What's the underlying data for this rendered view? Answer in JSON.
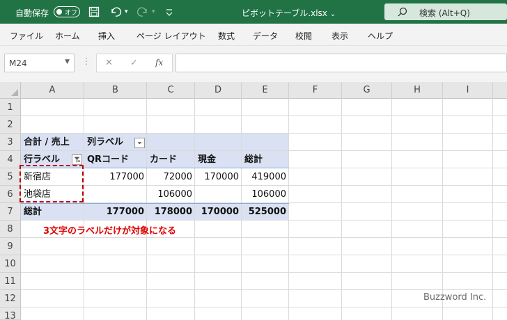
{
  "titlebar": {
    "autosave_label": "自動保存",
    "autosave_state": "オフ",
    "file_name": "ピボットテーブル.xlsx",
    "search_label": "検索 (Alt+Q)"
  },
  "ribbon_tabs": [
    "ファイル",
    "ホーム",
    "挿入",
    "ページ レイアウト",
    "数式",
    "データ",
    "校閲",
    "表示",
    "ヘルプ"
  ],
  "formula_bar": {
    "name_box": "M24",
    "fx": "fx",
    "value": ""
  },
  "columns": [
    "A",
    "B",
    "C",
    "D",
    "E",
    "F",
    "G",
    "H",
    "I"
  ],
  "rows": [
    "1",
    "2",
    "3",
    "4",
    "5",
    "6",
    "7",
    "8",
    "9",
    "10",
    "11",
    "12",
    "13"
  ],
  "pivot": {
    "header_value_label": "合計 / 売上",
    "column_labels": "列ラベル",
    "row_labels": "行ラベル",
    "column_headers": [
      "QRコード",
      "カード",
      "現金",
      "総計"
    ],
    "rows": [
      {
        "label": "新宿店",
        "values": [
          "177000",
          "72000",
          "170000",
          "419000"
        ]
      },
      {
        "label": "池袋店",
        "values": [
          "",
          "106000",
          "",
          "106000"
        ]
      }
    ],
    "total": {
      "label": "総計",
      "values": [
        "177000",
        "178000",
        "170000",
        "525000"
      ]
    }
  },
  "annotation": "3文字のラベルだけが対象になる",
  "watermark": "Buzzword Inc.",
  "colors": {
    "excel_green": "#217346",
    "pivot_fill": "#d9e1f2",
    "annotation_red": "#e00000"
  }
}
